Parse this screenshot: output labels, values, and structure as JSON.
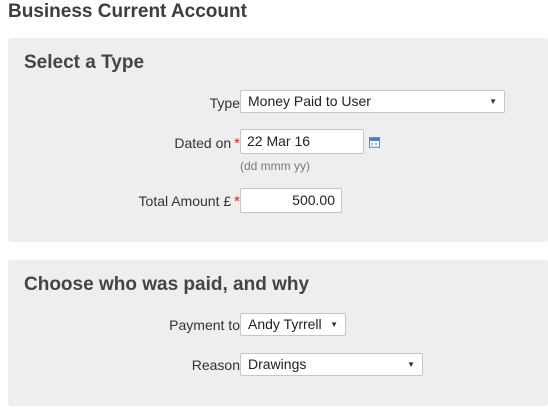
{
  "page": {
    "title": "Business Current Account"
  },
  "section1": {
    "title": "Select a Type",
    "type_label": "Type",
    "type_value": "Money Paid to User",
    "date_label": "Dated on",
    "date_value": "22 Mar 16",
    "date_hint": "(dd mmm yy)",
    "amount_label": "Total Amount £",
    "amount_value": "500.00",
    "required_marker": "*"
  },
  "section2": {
    "title": "Choose who was paid, and why",
    "payment_label": "Payment to",
    "payment_value": "Andy Tyrrell",
    "reason_label": "Reason",
    "reason_value": "Drawings"
  },
  "icons": {
    "dropdown_arrow": "▼",
    "calendar": "calendar-icon"
  }
}
